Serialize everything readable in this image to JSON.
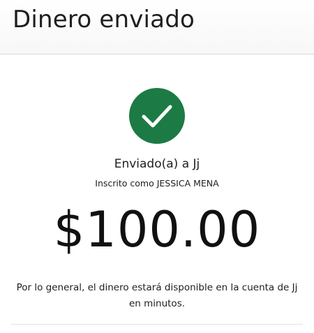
{
  "header": {
    "title": "Dinero enviado"
  },
  "confirmation": {
    "icon": "checkmark-icon",
    "icon_color": "#1c7a44",
    "sent_to": "Enviado(a) a Jj",
    "enrolled_as": "Inscrito como JESSICA MENA",
    "amount": "$100.00",
    "availability_note": "Por lo general, el dinero estará disponible en la cuenta de Jj en minutos."
  }
}
